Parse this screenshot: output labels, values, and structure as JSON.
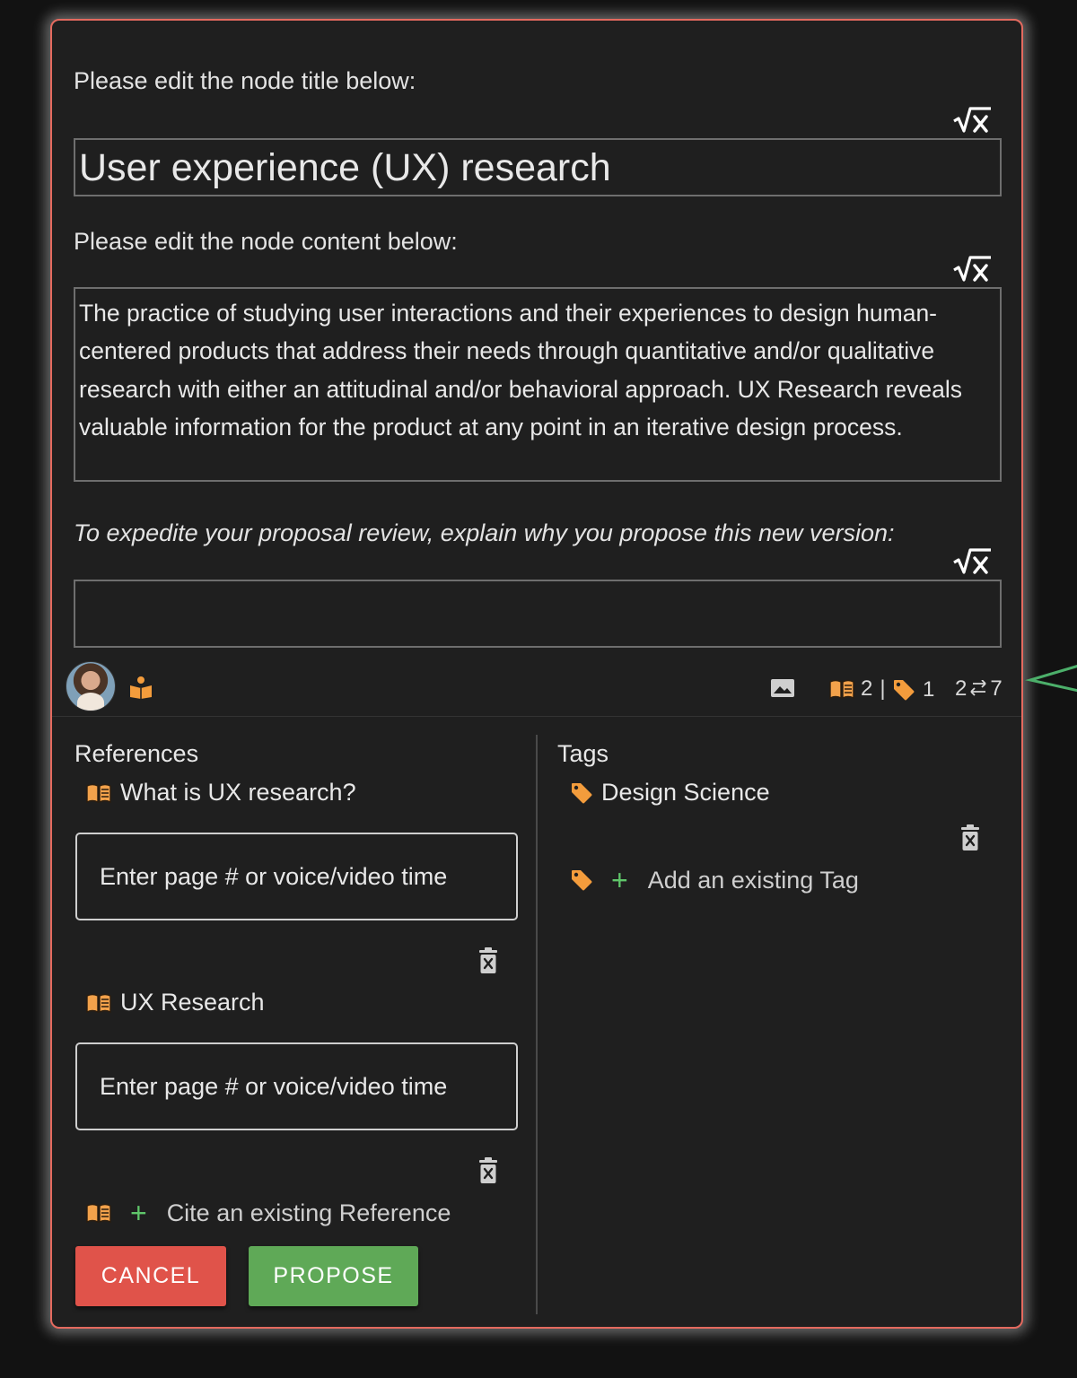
{
  "editor": {
    "title_label": "Please edit the node title below:",
    "title_value": "User experience (UX) research",
    "content_label": "Please edit the node content below:",
    "content_value": "The practice of studying user interactions and their experiences to design human-centered products that address their needs through quantitative and/or qualitative research with either an attitudinal and/or behavioral approach. UX Research reveals valuable information for the product at any point in an iterative design process.",
    "reason_label": "To expedite your proposal review, explain why you propose this new version:",
    "reason_value": ""
  },
  "toolbar": {
    "references_count": "2",
    "separator": "|",
    "tags_count": "1",
    "versions_left": "2",
    "versions_right": "7"
  },
  "references": {
    "title": "References",
    "items": [
      {
        "label": "What is UX research?",
        "page_placeholder": "Enter page # or voice/video time"
      },
      {
        "label": "UX Research",
        "page_placeholder": "Enter page # or voice/video time"
      }
    ],
    "add_label": "Cite an existing Reference"
  },
  "tags": {
    "title": "Tags",
    "items": [
      {
        "label": "Design Science"
      }
    ],
    "add_label": "Add an existing Tag"
  },
  "buttons": {
    "cancel": "CANCEL",
    "propose": "PROPOSE"
  },
  "colors": {
    "card_border": "#e46a5f",
    "accent_orange": "#f39c3c",
    "accent_green": "#5fc66a",
    "cancel_bg": "#e0534a",
    "propose_bg": "#5fa957"
  },
  "icons": {
    "math": "square-root-x-icon",
    "reference": "open-book-icon",
    "tag": "tag-icon",
    "delete": "trash-icon",
    "image": "image-icon",
    "version": "swap-arrows-icon",
    "proposer": "reader-person-icon"
  }
}
